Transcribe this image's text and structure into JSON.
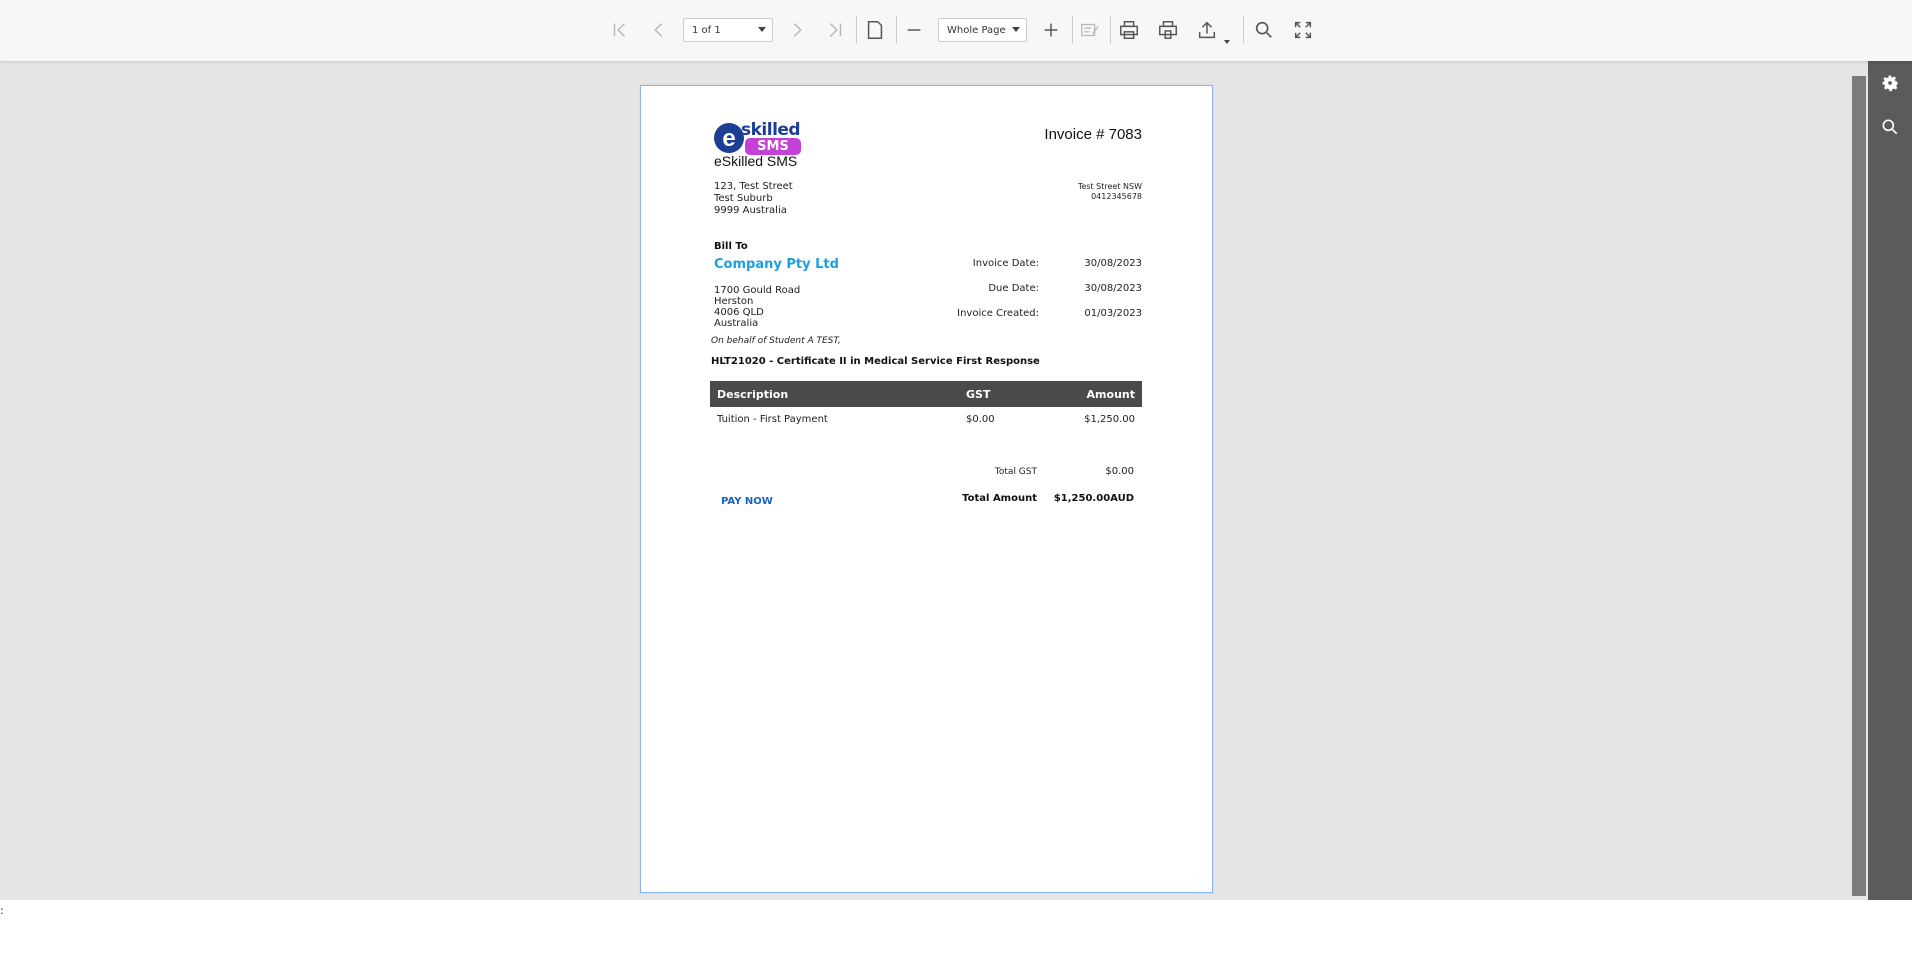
{
  "toolbar": {
    "page_indicator": "1 of 1",
    "zoom_mode": "Whole Page"
  },
  "invoice": {
    "brand_logo_line1": "skilled",
    "brand_logo_line2": "SMS",
    "brand_name": "eSkilled SMS",
    "title": "Invoice # 7083",
    "sender_address": [
      "123, Test Street",
      "Test Suburb",
      "9999 Australia"
    ],
    "sender_contact": [
      "Test Street NSW",
      "0412345678"
    ],
    "bill_to_label": "Bill To",
    "company_name": "Company Pty Ltd",
    "billing_address": [
      "1700 Gould Road",
      "Herston",
      "4006 QLD",
      "Australia"
    ],
    "invoice_date_label": "Invoice Date:",
    "invoice_date": "30/08/2023",
    "due_date_label": "Due Date:",
    "due_date": "30/08/2023",
    "invoice_created_label": "Invoice Created:",
    "invoice_created": "01/03/2023",
    "on_behalf": "On behalf of Student A TEST,",
    "course": "HLT21020 - Certificate II in Medical Service First Response",
    "table_headers": [
      "Description",
      "GST",
      "Amount"
    ],
    "items": [
      {
        "description": "Tuition - First Payment",
        "gst": "$0.00",
        "amount": "$1,250.00"
      }
    ],
    "total_gst_label": "Total GST",
    "total_gst": "$0.00",
    "total_amount_label": "Total Amount",
    "total_amount": "$1,250.00AUD",
    "pay_now": "PAY NOW"
  },
  "bottom_bar": {
    "text": ":"
  },
  "colors": {
    "accent": "#1ba1e2",
    "link": "#1565c0",
    "logo_blue": "#1c3f94",
    "logo_magenta": "#c341d6"
  }
}
